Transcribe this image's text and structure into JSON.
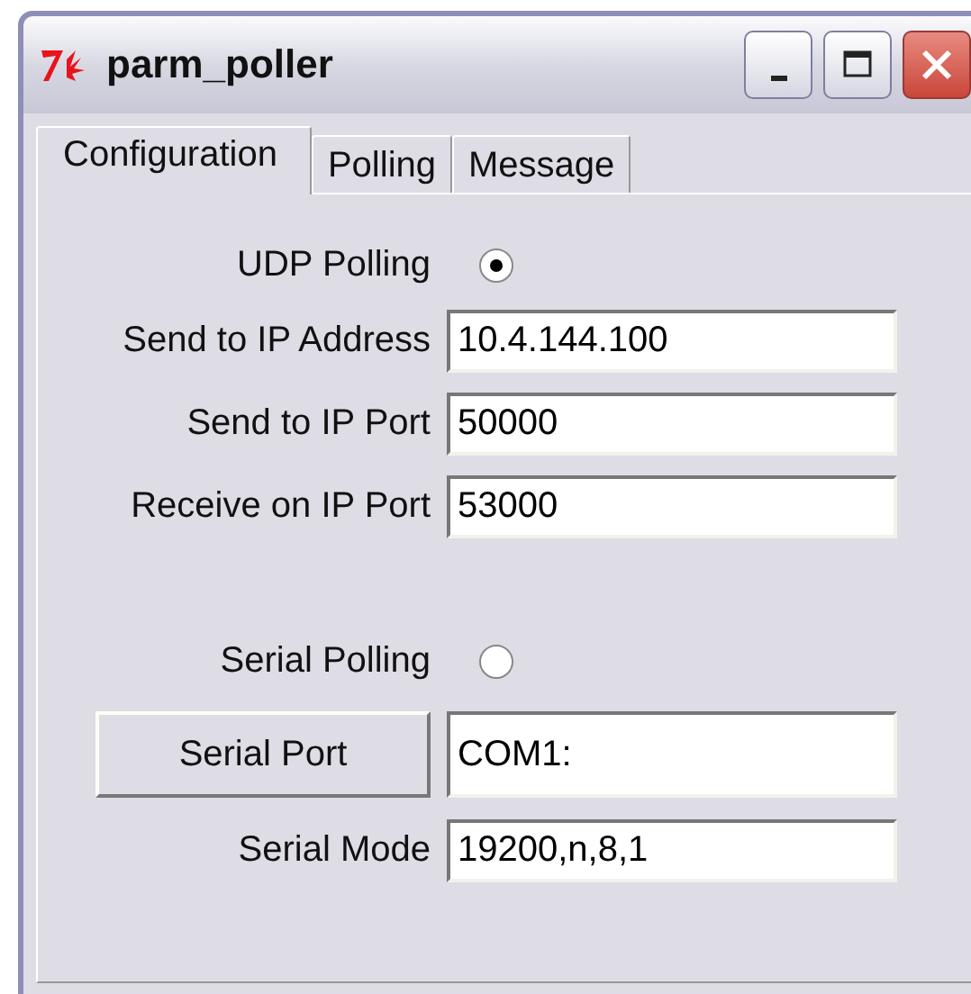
{
  "window": {
    "title": "parm_poller"
  },
  "tabs": [
    {
      "label": "Configuration",
      "selected": true
    },
    {
      "label": "Polling",
      "selected": false
    },
    {
      "label": "Message",
      "selected": false
    }
  ],
  "groups": [
    {
      "rows": [
        {
          "kind": "radio",
          "label": "UDP Polling",
          "checked": true
        },
        {
          "kind": "field",
          "label": "Send to IP Address",
          "value": "10.4.144.100"
        },
        {
          "kind": "field",
          "label": "Send to IP Port",
          "value": "50000"
        },
        {
          "kind": "field",
          "label": "Receive on IP Port",
          "value": "53000"
        }
      ]
    },
    {
      "rows": [
        {
          "kind": "radio",
          "label": "Serial Polling",
          "checked": false
        },
        {
          "kind": "button_field",
          "label": "Serial Port",
          "value": "COM1:"
        },
        {
          "kind": "field",
          "label": "Serial Mode",
          "value": "19200,n,8,1"
        }
      ]
    }
  ]
}
